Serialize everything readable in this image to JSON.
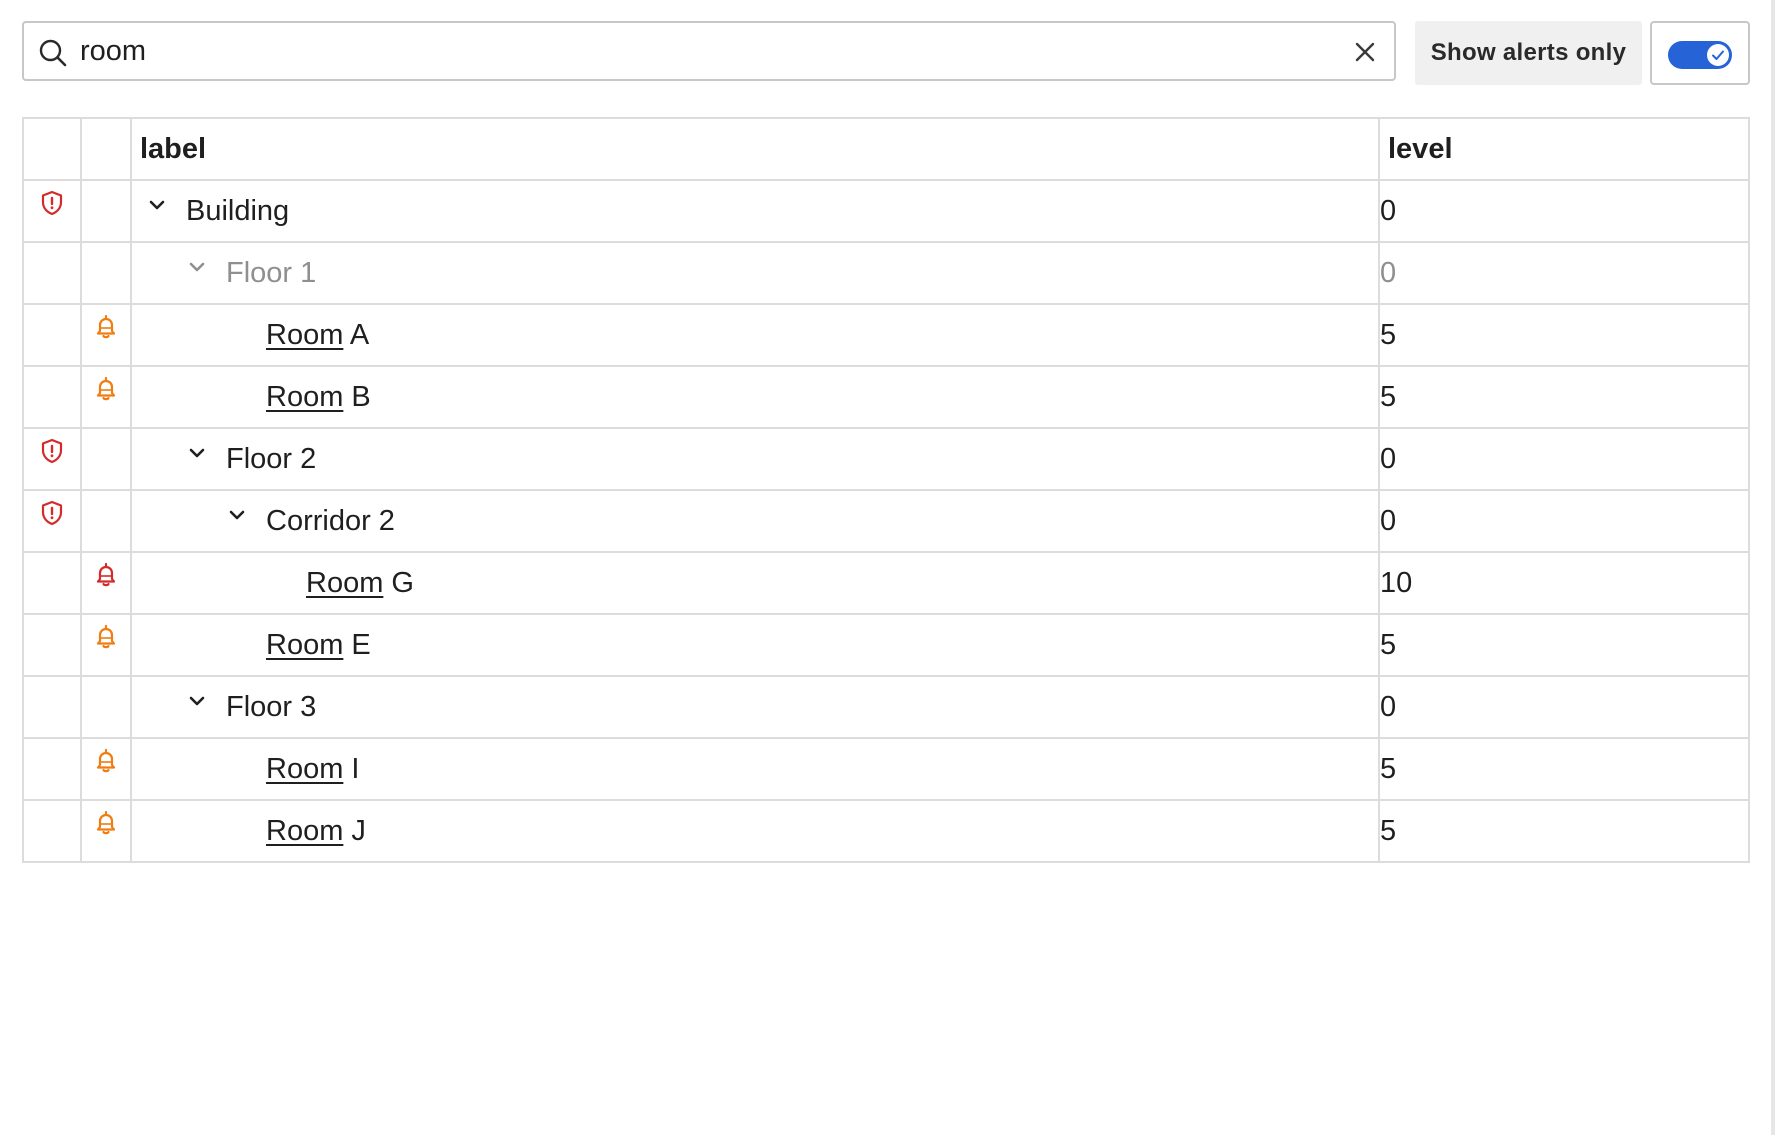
{
  "search": {
    "value": "room",
    "icon": "search-icon",
    "clear_icon": "close-icon"
  },
  "filter": {
    "label": "Show alerts only",
    "toggle_on": true
  },
  "table": {
    "headers": {
      "col1": "",
      "col2": "",
      "label": "label",
      "level": "level"
    },
    "rows": [
      {
        "severity_icon": "shield-alert-icon",
        "alarm_icon": "",
        "indent": 0,
        "expander": true,
        "match": "",
        "rest": "Building",
        "level": "0",
        "muted": false
      },
      {
        "severity_icon": "",
        "alarm_icon": "",
        "indent": 1,
        "expander": true,
        "match": "",
        "rest": "Floor 1",
        "level": "0",
        "muted": true
      },
      {
        "severity_icon": "",
        "alarm_icon": "bell-icon",
        "indent": 2,
        "expander": false,
        "match": "Room",
        "rest": " A",
        "level": "5",
        "muted": false
      },
      {
        "severity_icon": "",
        "alarm_icon": "bell-icon",
        "indent": 2,
        "expander": false,
        "match": "Room",
        "rest": " B",
        "level": "5",
        "muted": false
      },
      {
        "severity_icon": "shield-alert-icon",
        "alarm_icon": "",
        "indent": 1,
        "expander": true,
        "match": "",
        "rest": "Floor 2",
        "level": "0",
        "muted": false
      },
      {
        "severity_icon": "shield-alert-icon",
        "alarm_icon": "",
        "indent": 2,
        "expander": true,
        "match": "",
        "rest": "Corridor 2",
        "level": "0",
        "muted": false
      },
      {
        "severity_icon": "",
        "alarm_icon": "bell-critical-icon",
        "indent": 3,
        "expander": false,
        "match": "Room",
        "rest": " G",
        "level": "10",
        "muted": false
      },
      {
        "severity_icon": "",
        "alarm_icon": "bell-icon",
        "indent": 2,
        "expander": false,
        "match": "Room",
        "rest": " E",
        "level": "5",
        "muted": false
      },
      {
        "severity_icon": "",
        "alarm_icon": "",
        "indent": 1,
        "expander": true,
        "match": "",
        "rest": "Floor 3",
        "level": "0",
        "muted": false
      },
      {
        "severity_icon": "",
        "alarm_icon": "bell-icon",
        "indent": 2,
        "expander": false,
        "match": "Room",
        "rest": " I",
        "level": "5",
        "muted": false
      },
      {
        "severity_icon": "",
        "alarm_icon": "bell-icon",
        "indent": 2,
        "expander": false,
        "match": "Room",
        "rest": " J",
        "level": "5",
        "muted": false
      }
    ]
  },
  "colors": {
    "critical": "#d42a2a",
    "warning": "#f07c12",
    "accent": "#2563d6",
    "muted_text": "#8f8f8f"
  }
}
